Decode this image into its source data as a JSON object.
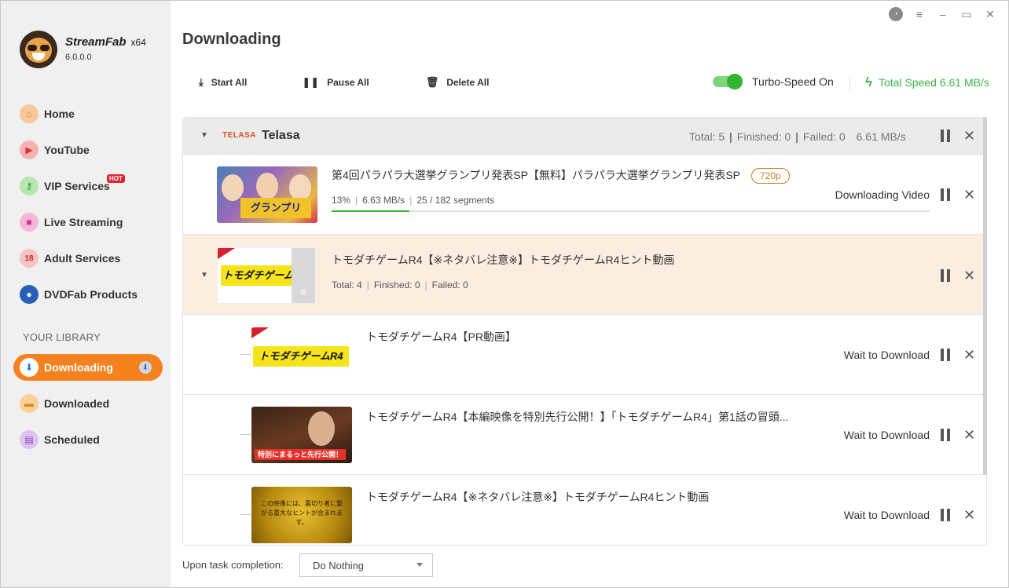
{
  "app": {
    "brand": "StreamFab",
    "arch": "x64",
    "version": "6.0.0.0"
  },
  "sidebar": {
    "items": [
      {
        "label": "Home",
        "icon": "home-icon"
      },
      {
        "label": "YouTube",
        "icon": "youtube-icon"
      },
      {
        "label": "VIP Services",
        "icon": "key-icon",
        "badge": "HOT"
      },
      {
        "label": "Live Streaming",
        "icon": "camera-icon"
      },
      {
        "label": "Adult Services",
        "icon": "18-plus-icon"
      },
      {
        "label": "DVDFab Products",
        "icon": "dvdfab-icon"
      }
    ],
    "library_label": "YOUR LIBRARY",
    "library": [
      {
        "label": "Downloading",
        "icon": "download-icon",
        "active": true
      },
      {
        "label": "Downloaded",
        "icon": "folder-icon"
      },
      {
        "label": "Scheduled",
        "icon": "calendar-icon"
      }
    ]
  },
  "main": {
    "title": "Downloading",
    "toolbar": {
      "start_all": "Start All",
      "pause_all": "Pause All",
      "delete_all": "Delete All"
    },
    "turbo_label": "Turbo-Speed On",
    "turbo_on": true,
    "total_speed": "Total Speed 6.61 MB/s"
  },
  "group": {
    "logo": "TELASA",
    "name": "Telasa",
    "total": "Total: 5",
    "finished": "Finished: 0",
    "failed": "Failed: 0",
    "speed": "6.61 MB/s"
  },
  "tasks": [
    {
      "title": "第4回パラパラ大選挙グランプリ発表SP【無料】パラパラ大選挙グランプリ発表SP",
      "resolution": "720p",
      "percent": "13%",
      "speed": "6.63 MB/s",
      "segments": "25 / 182 segments",
      "progress": 0.13,
      "status": "Downloading Video"
    },
    {
      "title": "トモダチゲームR4【※ネタバレ注意※】トモダチゲームR4ヒント動画",
      "total": "Total: 4",
      "finished": "Finished: 0",
      "failed": "Failed: 0",
      "thumb_text": "トモダチゲームR4",
      "children": [
        {
          "title": "トモダチゲームR4【PR動画】",
          "status": "Wait to Download",
          "thumb_text": "トモダチゲームR4"
        },
        {
          "title": "トモダチゲームR4【本編映像を特別先行公開！】「トモダチゲームR4」第1話の冒頭...",
          "status": "Wait to Download",
          "thumb_text": "特別にまるっと先行公開！"
        },
        {
          "title": "トモダチゲームR4【※ネタバレ注意※】トモダチゲームR4ヒント動画",
          "status": "Wait to Download",
          "thumb_text": "この映像には、裏切り者に繋がる重大なヒントが含まれます。"
        }
      ]
    }
  ],
  "footer": {
    "completion_label": "Upon task completion:",
    "completion_value": "Do Nothing"
  }
}
